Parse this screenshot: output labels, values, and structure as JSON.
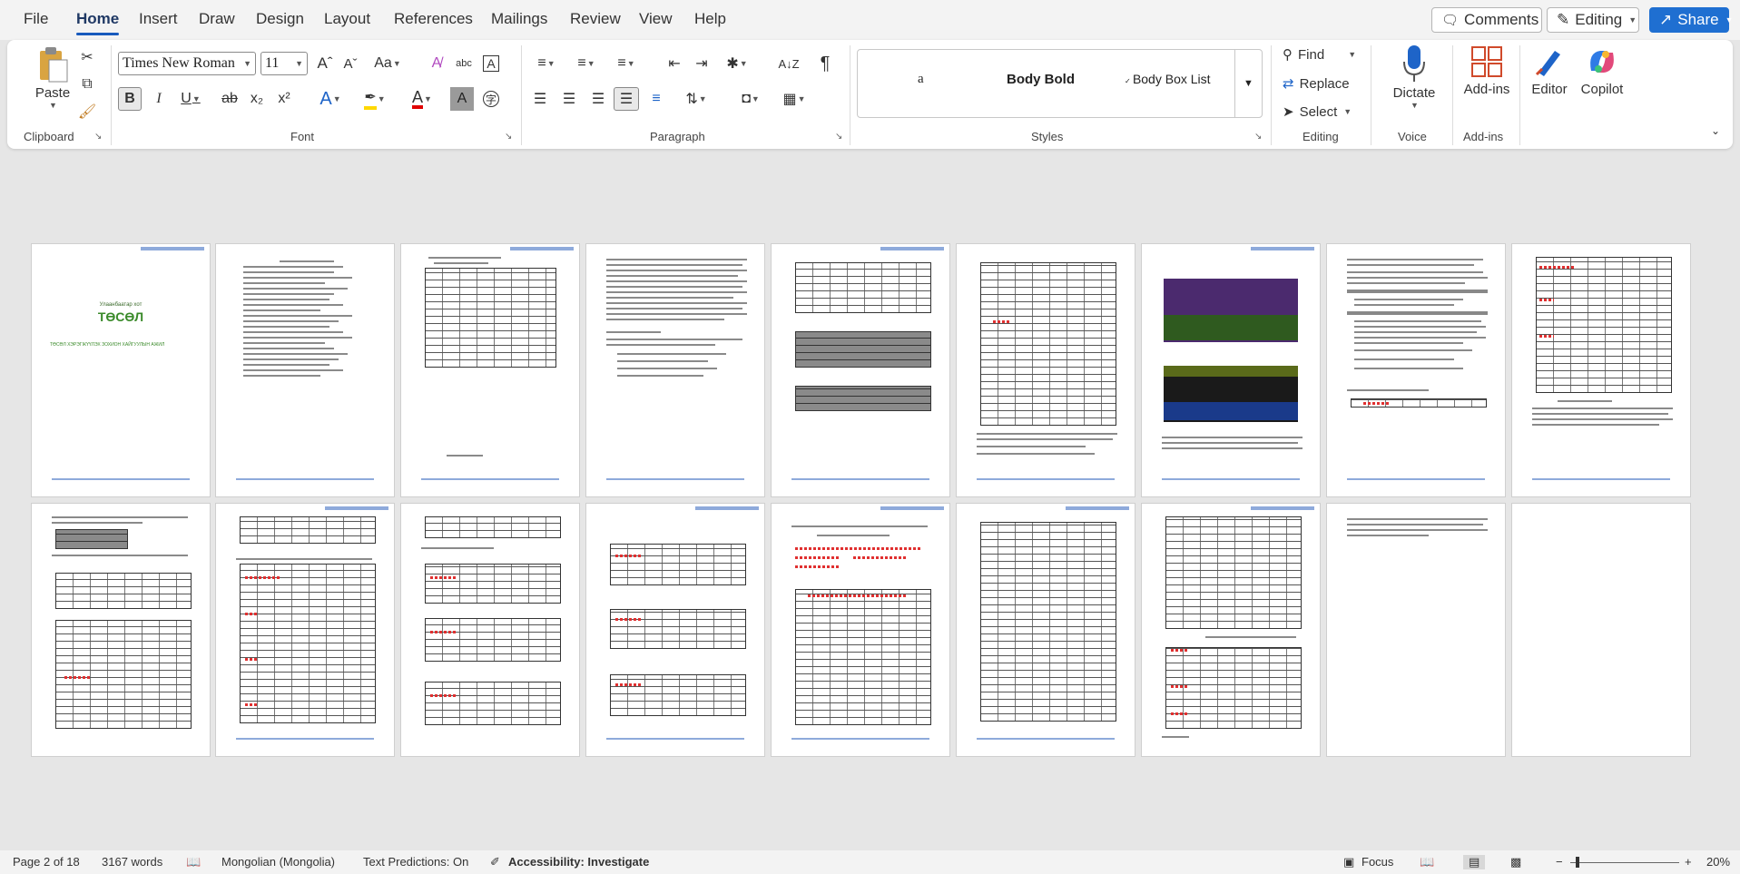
{
  "menu": {
    "items": [
      "File",
      "Home",
      "Insert",
      "Draw",
      "Design",
      "Layout",
      "References",
      "Mailings",
      "Review",
      "View",
      "Help"
    ],
    "active": "Home",
    "comments_label": "Comments",
    "editing_label": "Editing",
    "share_label": "Share"
  },
  "ribbon": {
    "clipboard": {
      "paste_label": "Paste",
      "group_label": "Clipboard"
    },
    "font": {
      "font_name": "Times New Roman",
      "font_size": "11",
      "group_label": "Font"
    },
    "paragraph": {
      "group_label": "Paragraph"
    },
    "styles": {
      "items": [
        "a",
        "Body Bold",
        "Body Box List"
      ],
      "group_label": "Styles"
    },
    "editing": {
      "find_label": "Find",
      "replace_label": "Replace",
      "select_label": "Select",
      "group_label": "Editing"
    },
    "voice": {
      "dictate_label": "Dictate",
      "group_label": "Voice"
    },
    "addins": {
      "addins_label": "Add-ins",
      "group_label": "Add-ins"
    },
    "editor_label": "Editor",
    "copilot_label": "Copilot"
  },
  "document": {
    "page1_title": "ТӨСӨЛ",
    "page1_org": "Улаанбаатар хот",
    "page1_subtitle": "ТӨСӨЛ ХЭРЭГЖҮҮЛЭХ ЗОХИОН ХАЙГУУЛЫН АЖИЛ"
  },
  "status": {
    "page": "Page 2 of 18",
    "words": "3167 words",
    "language": "Mongolian (Mongolia)",
    "text_predictions": "Text Predictions: On",
    "accessibility": "Accessibility: Investigate",
    "focus": "Focus",
    "zoom": "20%"
  },
  "colors": {
    "accent": "#185abd",
    "share_bg": "#1f6fd1",
    "page_header": "#8eaadb"
  }
}
